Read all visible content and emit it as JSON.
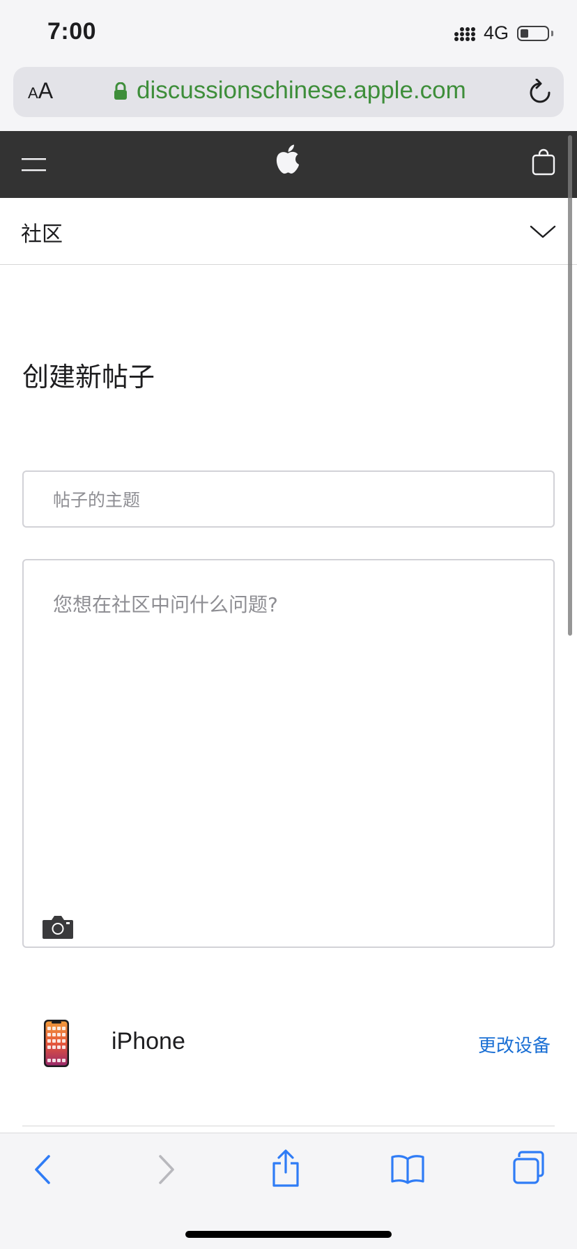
{
  "status_bar": {
    "time": "7:00",
    "network": "4G",
    "battery_level": 0.3
  },
  "address_bar": {
    "text_size_small": "A",
    "text_size_large": "A",
    "url": "discussionschinese.apple.com",
    "secure": true,
    "url_color": "#3e8e3a"
  },
  "global_nav": {
    "background": "#333333",
    "icons": [
      "menu-icon",
      "apple-logo",
      "bag-icon"
    ]
  },
  "community_nav": {
    "title": "社区"
  },
  "page": {
    "heading": "创建新帖子",
    "subject_placeholder": "帖子的主题",
    "subject_value": "",
    "question_placeholder": "您想在社区中问什么问题?",
    "question_value": ""
  },
  "device": {
    "name": "iPhone",
    "change_label": "更改设备",
    "link_color": "#1a6fd4"
  },
  "toolbar": {
    "icons": [
      "back-icon",
      "forward-icon",
      "share-icon",
      "bookmarks-icon",
      "tabs-icon"
    ],
    "accent": "#2f7cf6",
    "disabled": "#b8b8bd"
  }
}
